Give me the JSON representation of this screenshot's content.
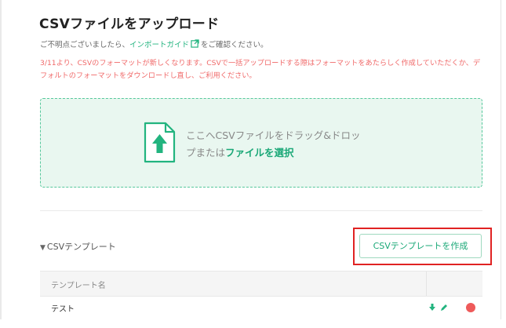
{
  "page": {
    "title": "CSVファイルをアップロード",
    "help_prefix": "ご不明点ございましたら、",
    "help_link": "インポートガイド",
    "help_suffix": "をご確認ください。",
    "notice": "3/11より、CSVのフォーマットが新しくなります。CSVで一括アップロードする際はフォーマットをあたらしく作成していただくか、デフォルトのフォーマットをダウンロードし直し、ご利用ください。"
  },
  "dropzone": {
    "line1": "ここへCSVファイルをドラッグ&ドロッ",
    "line2_prefix": "プまたは",
    "line2_link": "ファイルを選択"
  },
  "templates": {
    "toggle_arrow": "▼",
    "toggle_label": "CSVテンプレート",
    "create_button": "CSVテンプレートを作成",
    "column_name": "テンプレート名",
    "row_name": "テスト"
  },
  "colors": {
    "accent": "#1aa877",
    "notice": "#f06a6a",
    "highlight": "#e02222"
  }
}
